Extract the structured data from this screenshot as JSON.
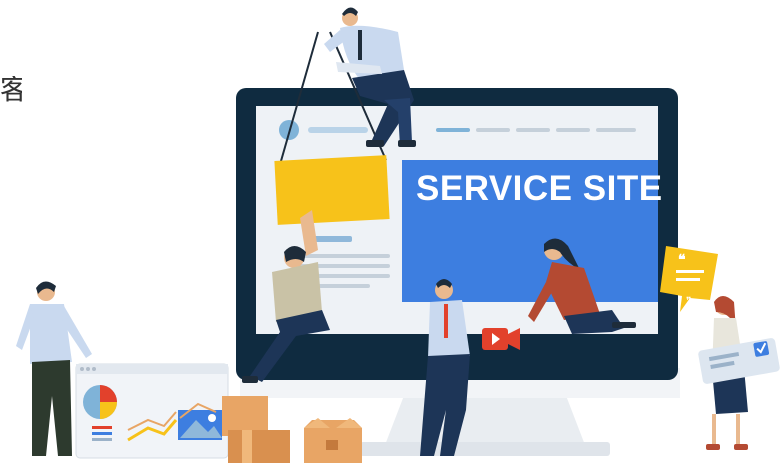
{
  "edge_text": "客",
  "banner": {
    "title": "SERVICE SITE"
  },
  "colors": {
    "monitor_frame": "#0f2b40",
    "screen_bg": "#eef2f6",
    "banner_blue": "#3d7ee0",
    "sign_yellow": "#f7c21a",
    "box_orange": "#e8a565",
    "video_red": "#e2412c",
    "stand_gray": "#e9edf1",
    "line_gray": "#c5d0da",
    "accent_blue": "#7fb3d8"
  },
  "icons": [
    "quote-bubble-icon",
    "video-camera-icon",
    "checkbox-icon",
    "pie-chart-icon"
  ]
}
